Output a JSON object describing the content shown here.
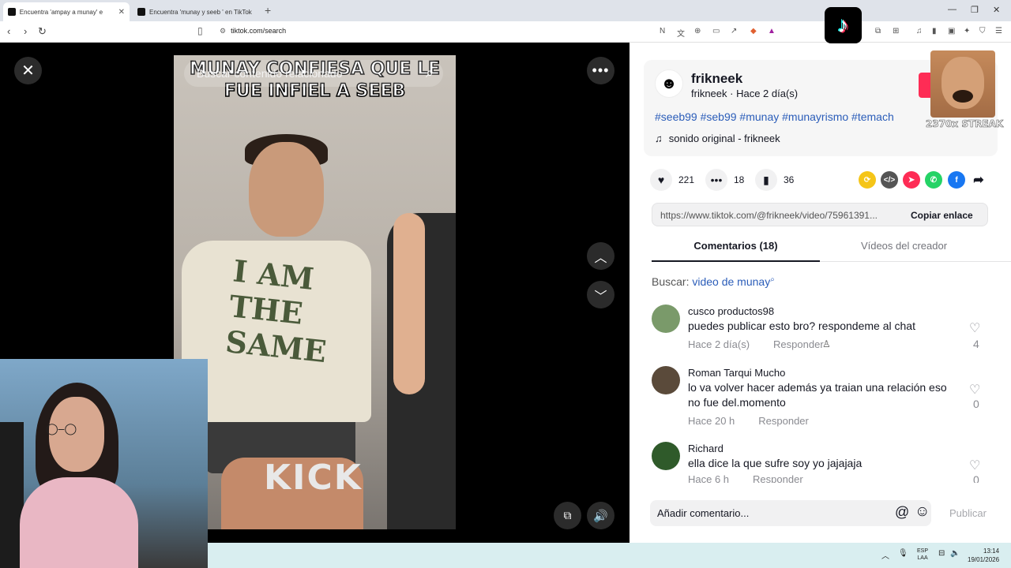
{
  "browser": {
    "tabs": [
      {
        "label": "Encuentra 'ampay a munay' e",
        "active": true
      },
      {
        "label": "Encuentra 'munay y seeb ' en TikTok",
        "active": false
      }
    ],
    "url": "tiktok.com/search"
  },
  "video": {
    "search_placeholder": "Buscar contenido relacionado",
    "overlay_title": "MUNAY CONFIESA QUE LE FUE INFIEL A SEEB",
    "shirt_text": "I AM THE SAME",
    "watermark": "KICK"
  },
  "post": {
    "username": "frikneek",
    "user_line": "frikneek · Hace 2 día(s)",
    "hashtags": "#seeb99 #seb99 #munay #munayrismo #temach",
    "sound": "sonido original - frikneek",
    "likes": "221",
    "comments_count": "18",
    "saves": "36",
    "link": "https://www.tiktok.com/@frikneek/video/75961391...",
    "copy_label": "Copiar enlace"
  },
  "streak_overlay": "2370x STREAK",
  "panel_tabs": [
    "Comentarios (18)",
    "Vídeos del creador"
  ],
  "search": {
    "prefix": "Buscar:",
    "term": "video de munay"
  },
  "comments": [
    {
      "name": "cusco productos98",
      "text": "puedes publicar esto bro? respondeme al chat",
      "time": "Hace 2 día(s)",
      "reply": "Responder",
      "likes": "4",
      "avatar_color": "#7a9a6a"
    },
    {
      "name": "Roman Tarqui Mucho",
      "text": "lo va volver hacer además ya traian una relación eso no fue del.momento",
      "time": "Hace 20 h",
      "reply": "Responder",
      "likes": "0",
      "avatar_color": "#5a4a3a"
    },
    {
      "name": "Richard",
      "text": "ella dice la que sufre soy yo jajajaja",
      "time": "Hace 6 h",
      "reply": "Responder",
      "likes": "0",
      "avatar_color": "#2f5a2a"
    }
  ],
  "comment_input": {
    "placeholder": "Añadir comentario...",
    "publish": "Publicar"
  },
  "taskbar": {
    "lang": "ESP",
    "layout": "LAA",
    "time": "13:14",
    "date": "19/01/2026"
  },
  "colors": {
    "accent": "#fe2c55",
    "hashtag": "#2b5db9"
  }
}
